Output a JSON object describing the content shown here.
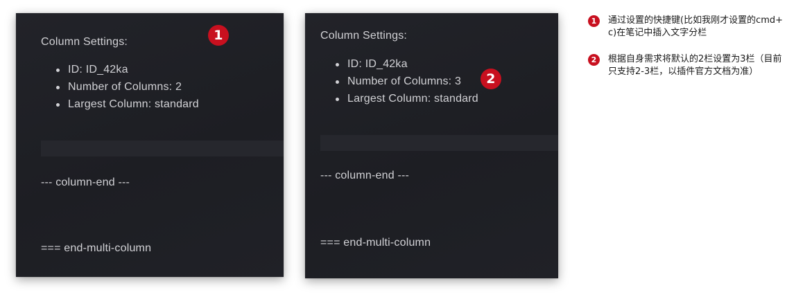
{
  "panel_before": {
    "heading": "Column Settings:",
    "settings": [
      "ID: ID_42ka",
      "Number of Columns: 2",
      "Largest Column: standard"
    ],
    "column_end": "--- column-end ---",
    "multi_end": "=== end-multi-column",
    "badge": "1"
  },
  "panel_after": {
    "heading": "Column Settings:",
    "settings": [
      "ID: ID_42ka",
      "Number of Columns: 3",
      "Largest Column: standard"
    ],
    "column_end": "--- column-end ---",
    "multi_end": "=== end-multi-column",
    "badge": "2"
  },
  "legend": [
    {
      "number": "1",
      "text": "通过设置的快捷键(比如我刚才设置的cmd+c)在笔记中插入文字分栏"
    },
    {
      "number": "2",
      "text": "根据自身需求将默认的2栏设置为3栏（目前只支持2-3栏，以插件官方文档为准）"
    }
  ],
  "colors": {
    "panel_background": "#1f2025",
    "panel_text": "#d2d2d6",
    "badge_red": "#c8101f",
    "legend_text": "#1a1a1a"
  }
}
